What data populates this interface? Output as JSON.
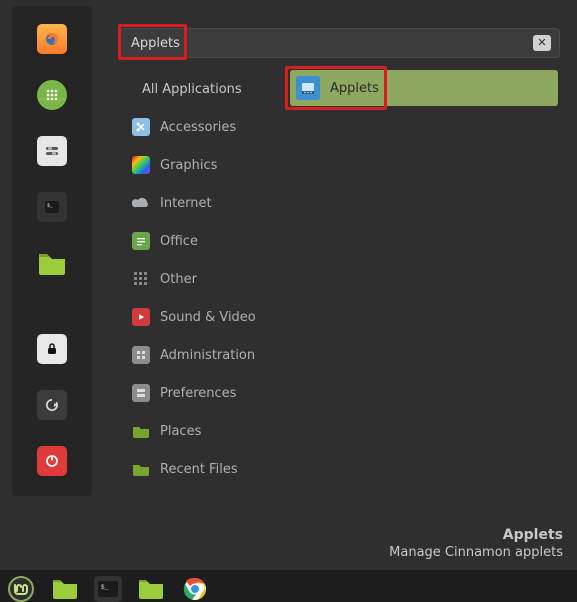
{
  "search": {
    "value": "Applets",
    "clear_glyph": "✕"
  },
  "categories": [
    {
      "id": "all",
      "label": "All Applications",
      "icon": null
    },
    {
      "id": "accessories",
      "label": "Accessories",
      "icon": "scissors"
    },
    {
      "id": "graphics",
      "label": "Graphics",
      "icon": "rainbow-square"
    },
    {
      "id": "internet",
      "label": "Internet",
      "icon": "cloud"
    },
    {
      "id": "office",
      "label": "Office",
      "icon": "doc-lines"
    },
    {
      "id": "other",
      "label": "Other",
      "icon": "dots-grid"
    },
    {
      "id": "soundvideo",
      "label": "Sound & Video",
      "icon": "play-triangle"
    },
    {
      "id": "administration",
      "label": "Administration",
      "icon": "admin-grid"
    },
    {
      "id": "preferences",
      "label": "Preferences",
      "icon": "prefs-tile"
    },
    {
      "id": "places",
      "label": "Places",
      "icon": "folder"
    },
    {
      "id": "recent",
      "label": "Recent Files",
      "icon": "folder"
    }
  ],
  "results": [
    {
      "label": "Applets",
      "icon": "applets-icon"
    }
  ],
  "selected_description": {
    "title": "Applets",
    "subtitle": "Manage Cinnamon applets"
  },
  "favorites": [
    {
      "id": "firefox",
      "name": "firefox-icon"
    },
    {
      "id": "dialer",
      "name": "dialpad-icon"
    },
    {
      "id": "settings",
      "name": "sliders-icon"
    },
    {
      "id": "terminal",
      "name": "terminal-icon"
    },
    {
      "id": "files",
      "name": "folder-icon"
    },
    {
      "id": "lock",
      "name": "lock-icon"
    },
    {
      "id": "logout",
      "name": "logout-icon"
    },
    {
      "id": "power",
      "name": "power-icon"
    }
  ],
  "taskbar": [
    {
      "id": "mint-menu",
      "name": "mint-logo-icon"
    },
    {
      "id": "files",
      "name": "folder-icon"
    },
    {
      "id": "terminal",
      "name": "terminal-icon"
    },
    {
      "id": "files2",
      "name": "folder-icon"
    },
    {
      "id": "chrome",
      "name": "chrome-icon"
    }
  ],
  "colors": {
    "accent": "#8fa85f",
    "highlight": "#d91c1c",
    "bg": "#2f2f2f"
  }
}
